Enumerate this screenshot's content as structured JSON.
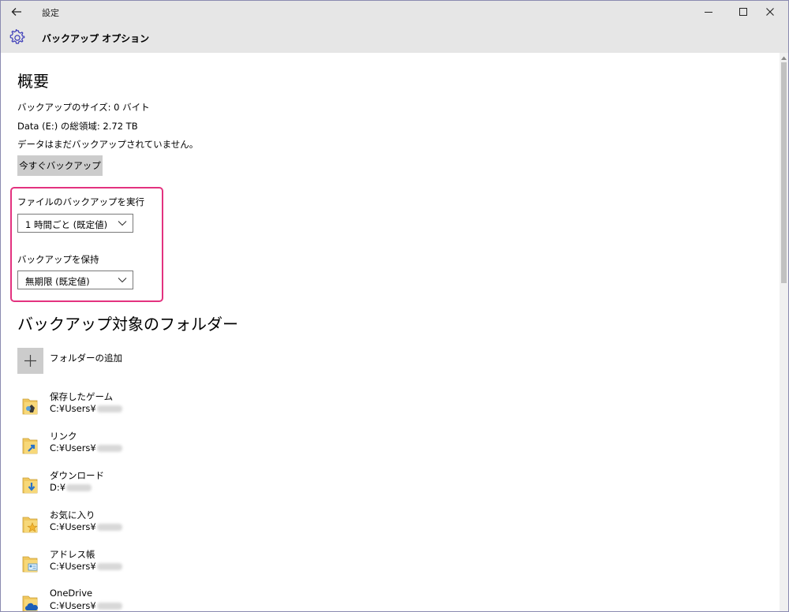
{
  "window": {
    "app_title": "設定",
    "page_title": "バックアップ オプション"
  },
  "overview": {
    "heading": "概要",
    "backup_size": "バックアップのサイズ: 0 バイト",
    "total_space": "Data (E:) の総領域: 2.72 TB",
    "status": "データはまだバックアップされていません。",
    "backup_now_label": "今すぐバックアップ"
  },
  "settings": {
    "frequency_label": "ファイルのバックアップを実行",
    "frequency_value": "1 時間ごと (既定値)",
    "retention_label": "バックアップを保持",
    "retention_value": "無期限 (既定値)",
    "highlight_color": "#e3327f"
  },
  "folders": {
    "heading": "バックアップ対象のフォルダー",
    "add_label": "フォルダーの追加",
    "items": [
      {
        "name": "保存したゲーム",
        "path": "C:¥Users¥",
        "icon": "saved-games-folder-icon"
      },
      {
        "name": "リンク",
        "path": "C:¥Users¥",
        "icon": "links-folder-icon"
      },
      {
        "name": "ダウンロード",
        "path": "D:¥",
        "icon": "downloads-folder-icon"
      },
      {
        "name": "お気に入り",
        "path": "C:¥Users¥",
        "icon": "favorites-folder-icon"
      },
      {
        "name": "アドレス帳",
        "path": "C:¥Users¥",
        "icon": "contacts-folder-icon"
      },
      {
        "name": "OneDrive",
        "path": "C:¥Users¥",
        "icon": "onedrive-folder-icon"
      }
    ]
  }
}
